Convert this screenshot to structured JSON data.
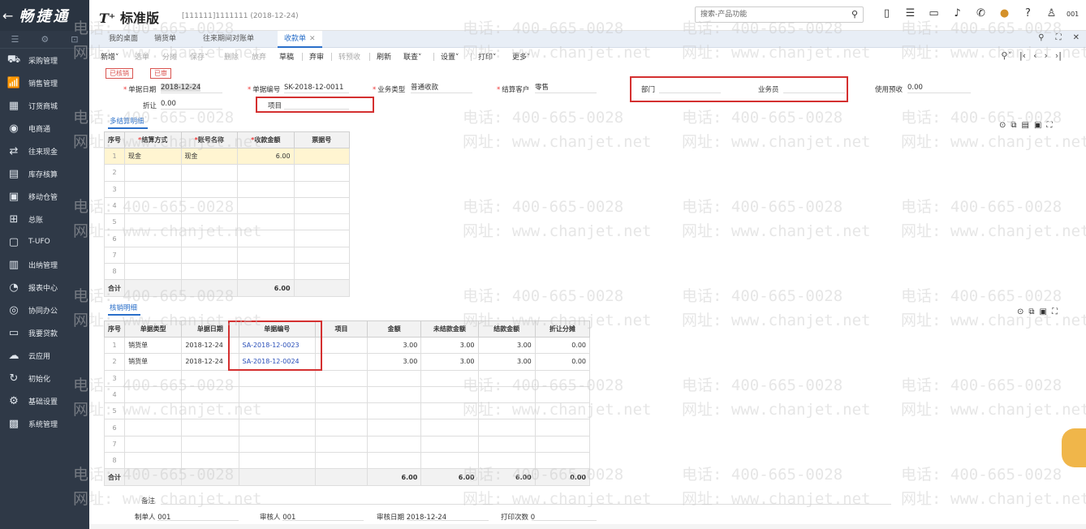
{
  "sidebar": {
    "brand": "畅捷通",
    "back_icon": "←",
    "tools": [
      "☰",
      "⚙",
      "⊡"
    ],
    "items": [
      {
        "label": "采购管理",
        "icon": "cart-icon",
        "glyph": "⛟"
      },
      {
        "label": "销售管理",
        "icon": "chart-icon",
        "glyph": "📶"
      },
      {
        "label": "订货商城",
        "icon": "store-icon",
        "glyph": "▦"
      },
      {
        "label": "电商通",
        "icon": "ecommerce-icon",
        "glyph": "◉"
      },
      {
        "label": "往来现金",
        "icon": "exchange-icon",
        "glyph": "⇄"
      },
      {
        "label": "库存核算",
        "icon": "inventory-icon",
        "glyph": "▤"
      },
      {
        "label": "移动仓管",
        "icon": "mobile-warehouse-icon",
        "glyph": "▣"
      },
      {
        "label": "总账",
        "icon": "ledger-icon",
        "glyph": "⊞"
      },
      {
        "label": "T-UFO",
        "icon": "ufo-icon",
        "glyph": "▢"
      },
      {
        "label": "出纳管理",
        "icon": "cashier-icon",
        "glyph": "▥"
      },
      {
        "label": "报表中心",
        "icon": "report-icon",
        "glyph": "◔"
      },
      {
        "label": "协同办公",
        "icon": "collab-icon",
        "glyph": "◎"
      },
      {
        "label": "我要贷款",
        "icon": "loan-icon",
        "glyph": "▭"
      },
      {
        "label": "云应用",
        "icon": "cloud-icon",
        "glyph": "☁"
      },
      {
        "label": "初始化",
        "icon": "init-icon",
        "glyph": "↻"
      },
      {
        "label": "基础设置",
        "icon": "settings-icon",
        "glyph": "⚙"
      },
      {
        "label": "系统管理",
        "icon": "system-icon",
        "glyph": "▩"
      }
    ]
  },
  "header": {
    "logo_t": "T⁺",
    "logo_text": "标准版",
    "account": "[111111]1111111  (2018-12-24)",
    "search_placeholder": "搜索-产品功能",
    "user": "001"
  },
  "tabs": [
    {
      "label": "我的桌面"
    },
    {
      "label": "销货单"
    },
    {
      "label": "往来期间对账单"
    },
    {
      "label": "收款单"
    }
  ],
  "toolbar": {
    "buttons": [
      "新增",
      "选单",
      "分摊",
      "保存",
      "删除",
      "放弃",
      "草稿",
      "弃审",
      "转预收",
      "刷新",
      "联查",
      "设置",
      "打印",
      "更多"
    ]
  },
  "form": {
    "status1": "已核销",
    "status2": "已审",
    "date_label": "单据日期",
    "date_value": "2018-12-24",
    "code_label": "单据编号",
    "code_value": "SK-2018-12-0011",
    "biztype_label": "业务类型",
    "biztype_value": "普通收款",
    "customer_label": "结算客户",
    "customer_value": "零售",
    "dept_label": "部门",
    "clerk_label": "业务员",
    "prepay_label": "使用预收",
    "prepay_value": "0.00",
    "discount_label": "折让",
    "discount_value": "0.00",
    "project_label": "项目"
  },
  "settle": {
    "title": "多结算明细",
    "headers": [
      "序号",
      "结算方式",
      "账号名称",
      "收款金额",
      "票据号"
    ],
    "rows": [
      [
        "1",
        "现金",
        "现金",
        "6.00",
        ""
      ],
      [
        "2",
        "",
        "",
        "",
        ""
      ],
      [
        "3",
        "",
        "",
        "",
        ""
      ],
      [
        "4",
        "",
        "",
        "",
        ""
      ],
      [
        "5",
        "",
        "",
        "",
        ""
      ],
      [
        "6",
        "",
        "",
        "",
        ""
      ],
      [
        "7",
        "",
        "",
        "",
        ""
      ],
      [
        "8",
        "",
        "",
        "",
        ""
      ]
    ],
    "total_label": "合计",
    "total_amount": "6.00"
  },
  "writeoff": {
    "title": "核销明细",
    "headers": [
      "序号",
      "单据类型",
      "单据日期",
      "单据编号",
      "项目",
      "金额",
      "未结款金额",
      "结款金额",
      "折让分摊"
    ],
    "rows": [
      [
        "1",
        "销货单",
        "2018-12-24",
        "SA-2018-12-0023",
        "",
        "3.00",
        "3.00",
        "3.00",
        "0.00"
      ],
      [
        "2",
        "销货单",
        "2018-12-24",
        "SA-2018-12-0024",
        "",
        "3.00",
        "3.00",
        "3.00",
        "0.00"
      ],
      [
        "3",
        "",
        "",
        "",
        "",
        "",
        "",
        "",
        ""
      ],
      [
        "4",
        "",
        "",
        "",
        "",
        "",
        "",
        "",
        ""
      ],
      [
        "5",
        "",
        "",
        "",
        "",
        "",
        "",
        "",
        ""
      ],
      [
        "6",
        "",
        "",
        "",
        "",
        "",
        "",
        "",
        ""
      ],
      [
        "7",
        "",
        "",
        "",
        "",
        "",
        "",
        "",
        ""
      ],
      [
        "8",
        "",
        "",
        "",
        "",
        "",
        "",
        "",
        ""
      ]
    ],
    "total_label": "合计",
    "totals": [
      "6.00",
      "6.00",
      "6.00",
      "0.00"
    ]
  },
  "footer": {
    "remark_label": "备注",
    "maker_label": "制单人",
    "maker_value": "001",
    "auditor_label": "审核人",
    "auditor_value": "001",
    "auditdate_label": "审核日期",
    "auditdate_value": "2018-12-24",
    "printcount_label": "打印次数",
    "printcount_value": "0"
  },
  "watermark": {
    "phone": "电话: 400-665-0028",
    "web": "网址: www.chanjet.net"
  }
}
